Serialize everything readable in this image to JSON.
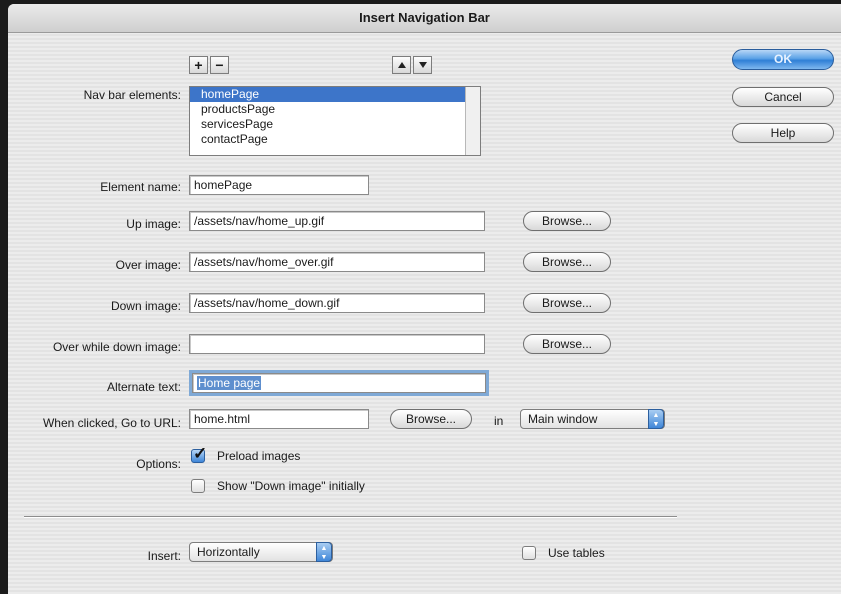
{
  "window": {
    "title": "Insert Navigation Bar"
  },
  "toolbar": {
    "add_icon": "plus-icon",
    "remove_icon": "minus-icon",
    "move_up_icon": "arrow-up-icon",
    "move_down_icon": "arrow-down-icon"
  },
  "nav_elements": {
    "label": "Nav bar elements:",
    "items": [
      "homePage",
      "productsPage",
      "servicesPage",
      "contactPage"
    ],
    "selected": "homePage"
  },
  "fields": {
    "element_name": {
      "label": "Element name:",
      "value": "homePage"
    },
    "up_image": {
      "label": "Up image:",
      "value": "/assets/nav/home_up.gif"
    },
    "over_image": {
      "label": "Over image:",
      "value": "/assets/nav/home_over.gif"
    },
    "down_image": {
      "label": "Down image:",
      "value": "/assets/nav/home_down.gif"
    },
    "over_while_down_image": {
      "label": "Over while down image:",
      "value": ""
    },
    "alternate_text": {
      "label": "Alternate text:",
      "value": "Home page"
    },
    "go_to_url": {
      "label": "When clicked, Go to URL:",
      "value": "home.html"
    }
  },
  "browse_label": "Browse...",
  "in_label": "in",
  "target_window": "Main window",
  "options": {
    "label": "Options:",
    "preload_images": {
      "label": "Preload images",
      "checked": true
    },
    "show_down_image": {
      "label": "Show \"Down image\" initially",
      "checked": false
    }
  },
  "insert": {
    "label": "Insert:",
    "value": "Horizontally"
  },
  "use_tables": {
    "label": "Use tables",
    "checked": false
  },
  "buttons": {
    "ok": "OK",
    "cancel": "Cancel",
    "help": "Help"
  },
  "colors": {
    "accent": "#3d75c9",
    "focus_ring": "#7fa9d6",
    "primary_button": "#5aa1e6"
  }
}
